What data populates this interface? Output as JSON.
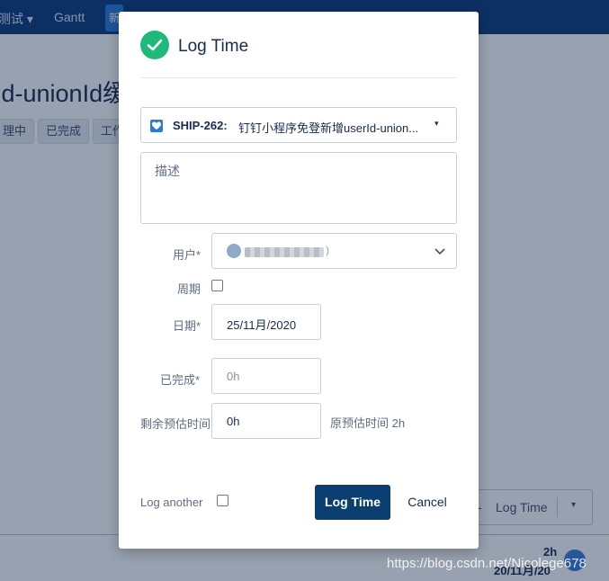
{
  "background": {
    "nav_item_1": "测试 ▾",
    "nav_item_2": "Gantt",
    "nav_button_char": "新",
    "page_title": "Id-unionId缓",
    "tabs": [
      "理中",
      "已完成",
      "工作"
    ],
    "log_time_button": "Log Time",
    "dash": "-",
    "dropdown_glyph": "▾",
    "total_time": "2h",
    "worklog_date": "20/11月/20",
    "watermark": "https://blog.csdn.net/Nicolege678"
  },
  "dialog": {
    "title": "Log Time",
    "issue": {
      "key": "SHIP-262:",
      "summary": "钉钉小程序免登新增userId-union...",
      "type_icon": "story-icon",
      "caret": "▾"
    },
    "description_placeholder": "描述",
    "user": {
      "label": "用户*",
      "value_tail": ")"
    },
    "recurring": {
      "label": "周期",
      "checked": false
    },
    "date": {
      "label": "日期*",
      "value": "25/11月/2020"
    },
    "time_spent": {
      "label": "已完成*",
      "placeholder": "0h"
    },
    "remaining": {
      "label": "剩余预估时间",
      "value": "0h",
      "original_estimate": "原预估时间 2h"
    },
    "log_another": {
      "label": "Log another",
      "checked": false
    },
    "submit_label": "Log Time",
    "cancel_label": "Cancel"
  },
  "colors": {
    "primary": "#0b3f72",
    "success": "#1fba7a",
    "header": "#0f3d7a"
  }
}
